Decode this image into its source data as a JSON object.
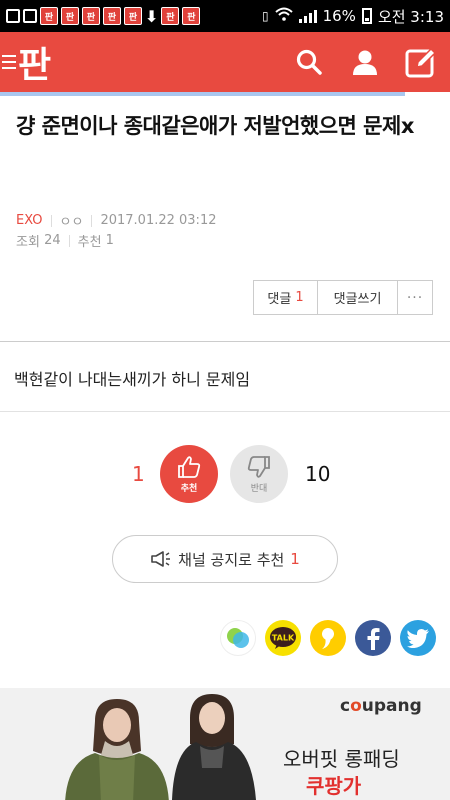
{
  "status_bar": {
    "battery": "16%",
    "time_label": "오전 3:13",
    "notification_icon_text": "판"
  },
  "header": {
    "logo": "판",
    "icons": [
      "search-icon",
      "user-icon",
      "edit-icon"
    ],
    "color": "#e84a40"
  },
  "article": {
    "title": "걍 준면이나 종대같은애가 저발언했으면 문제x",
    "category": "EXO",
    "author": "ㅇㅇ",
    "date": "2017.01.22 03:12",
    "views_label": "조회",
    "views": "24",
    "recommends_label": "추천",
    "recommends": "1",
    "body": "백현같이 나대는새끼가 하니 문제임"
  },
  "comment_bar": {
    "comments_label": "댓글",
    "comments_count": "1",
    "write_label": "댓글쓰기",
    "more_label": "···"
  },
  "votes": {
    "up_count": "1",
    "up_label": "추천",
    "down_label": "반대",
    "down_count": "10"
  },
  "notice_button": {
    "label": "채널 공지로 추천",
    "count": "1"
  },
  "share": {
    "items": [
      "band-icon",
      "kakaotalk-icon",
      "kakaostory-icon",
      "facebook-icon",
      "twitter-icon"
    ],
    "talk_label": "TALK"
  },
  "ad": {
    "brand_pre": "c",
    "brand_o": "o",
    "brand_post": "upang",
    "line1": "오버핏 롱패딩",
    "line2": "쿠팡가"
  }
}
